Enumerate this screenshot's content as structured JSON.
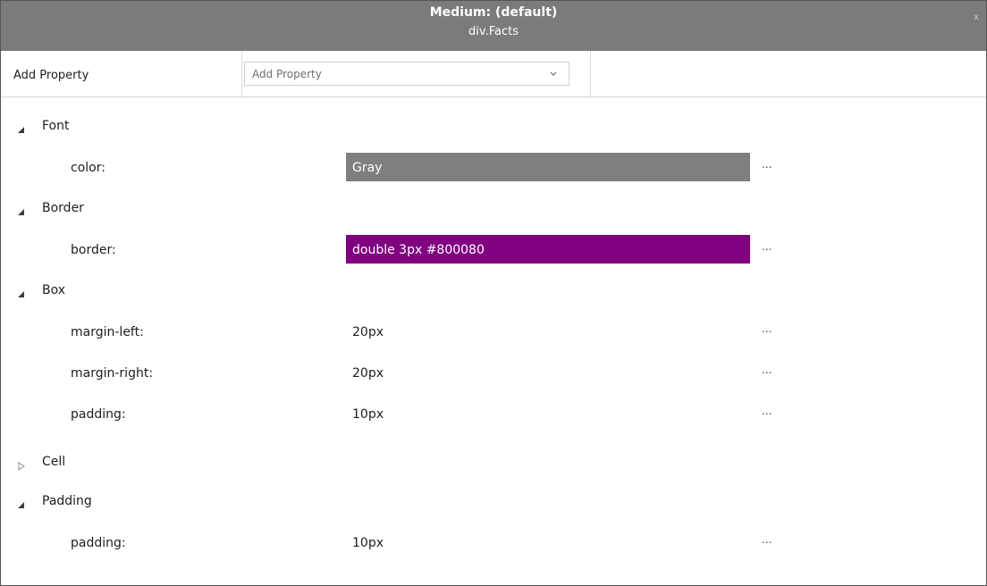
{
  "window": {
    "title": "Medium: (default)",
    "subtitle": "div.Facts",
    "close_glyph": "x"
  },
  "add_property": {
    "label": "Add Property",
    "select_value": "Add Property",
    "chevron_icon": "chevron-down-icon"
  },
  "categories": [
    {
      "name": "Font",
      "expanded": true,
      "properties": [
        {
          "name": "color:",
          "value": "Gray",
          "swatch": "#7f7f7f",
          "more": "..."
        }
      ]
    },
    {
      "name": "Border",
      "expanded": true,
      "properties": [
        {
          "name": "border:",
          "value": "double 3px #800080",
          "swatch": "#800080",
          "more": "..."
        }
      ]
    },
    {
      "name": "Box",
      "expanded": true,
      "properties": [
        {
          "name": "margin-left:",
          "value": "20px",
          "more": "..."
        },
        {
          "name": "margin-right:",
          "value": "20px",
          "more": "..."
        },
        {
          "name": "padding:",
          "value": "10px",
          "more": "..."
        }
      ]
    },
    {
      "name": "Cell",
      "expanded": false,
      "properties": []
    },
    {
      "name": "Padding",
      "expanded": true,
      "properties": [
        {
          "name": "padding:",
          "value": "10px",
          "more": "..."
        }
      ]
    }
  ],
  "colors": {
    "titlebar": "#7b7b7b",
    "gray_swatch": "#7f7f7f",
    "purple_swatch": "#800080"
  }
}
